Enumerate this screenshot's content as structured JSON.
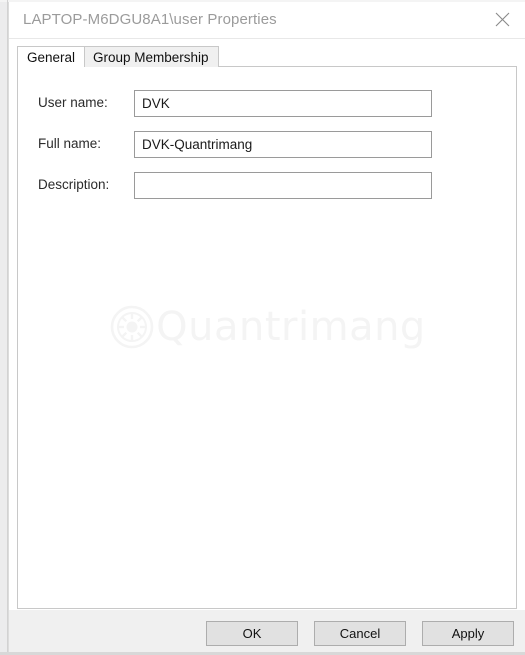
{
  "window": {
    "title": "LAPTOP-M6DGU8A1\\user Properties",
    "close_icon": "close-icon",
    "title_color": "#9b9b9b"
  },
  "tabs": [
    {
      "label": "General",
      "selected": true
    },
    {
      "label": "Group Membership",
      "selected": false
    }
  ],
  "general_tab": {
    "fields": [
      {
        "label": "User name:",
        "value": "DVK",
        "placeholder": ""
      },
      {
        "label": "Full name:",
        "value": "DVK-Quantrimang",
        "placeholder": ""
      },
      {
        "label": "Description:",
        "value": "",
        "placeholder": ""
      }
    ]
  },
  "watermark": {
    "text": "Quantrimang",
    "logo_icon": "quantrimang-gear-logo-icon",
    "color": "#f4f4f4"
  },
  "footer": {
    "buttons": [
      {
        "label": "OK"
      },
      {
        "label": "Cancel"
      },
      {
        "label": "Apply"
      }
    ]
  },
  "colors": {
    "window_background": "#ffffff",
    "panel_border": "#c8c8c8",
    "footer_background": "#f0f0f0",
    "button_face": "#e1e1e1",
    "button_border": "#adadad",
    "input_border": "#9a9a9a",
    "text": "#2b2b2b"
  }
}
